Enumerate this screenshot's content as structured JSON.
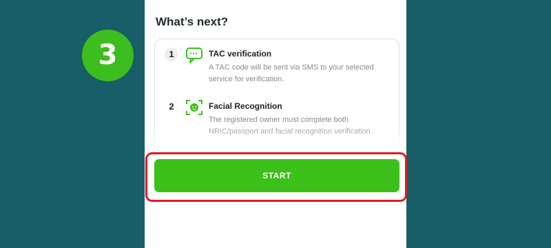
{
  "step_badge": {
    "number": "3"
  },
  "section": {
    "title": "What’s next?"
  },
  "steps": [
    {
      "number": "1",
      "icon": "chat-bubble-icon",
      "title": "TAC verification",
      "description": "A TAC code will be sent via SMS to your selected service for verification."
    },
    {
      "number": "2",
      "icon": "face-scan-icon",
      "title": "Facial Recognition",
      "description": "The registered owner must complete both NRIC/passport and facial recognition verification."
    }
  ],
  "start_button": {
    "label": "START"
  },
  "colors": {
    "background": "#175e66",
    "accent_green": "#3cc01a",
    "highlight_red": "#e01b22"
  }
}
